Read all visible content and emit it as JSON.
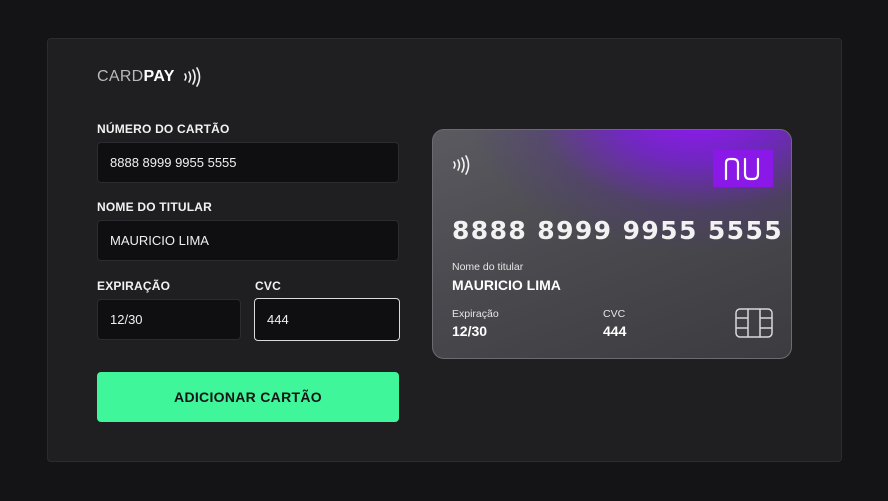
{
  "brand": {
    "light": "CARD",
    "bold": "PAY",
    "icon": "contactless-icon"
  },
  "form": {
    "card_number_label": "NÚMERO DO CARTÃO",
    "card_number_value": "8888 8999 9955 5555",
    "holder_label": "NOME DO TITULAR",
    "holder_value": "MAURICIO LIMA",
    "expiry_label": "EXPIRAÇÃO",
    "expiry_value": "12/30",
    "cvc_label": "CVC",
    "cvc_value": "444",
    "submit_label": "ADICIONAR CARTÃO"
  },
  "card": {
    "number": "8888 8999 9955 5555",
    "holder_label": "Nome do titular",
    "holder": "MAURICIO LIMA",
    "expiry_label": "Expiração",
    "expiry": "12/30",
    "cvc_label": "CVC",
    "cvc": "444",
    "logo_icon": "nubank-logo",
    "chip_icon": "chip-icon"
  },
  "colors": {
    "accent": "#3ff79a",
    "card_purple": "#8a18e6",
    "panel": "#1f1f22",
    "background": "#141416"
  }
}
